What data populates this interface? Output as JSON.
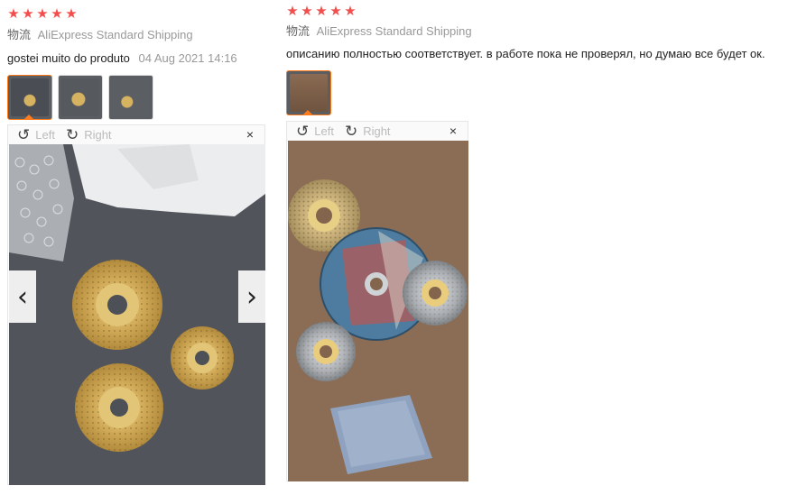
{
  "reviews": [
    {
      "stars": 5,
      "shipping_label": "物流",
      "shipping_method": "AliExpress Standard Shipping",
      "comment": "gostei muito do produto",
      "date": "04 Aug 2021 14:16",
      "thumbnails": 3,
      "viewer": {
        "rotate_left": "Left",
        "rotate_right": "Right",
        "close": "×",
        "prev": "‹",
        "next": "›"
      }
    },
    {
      "stars": 5,
      "shipping_label": "物流",
      "shipping_method": "AliExpress Standard Shipping",
      "comment": "описанию полностью соответствует. в работе пока не проверял, но думаю все будет ок.",
      "thumbnails": 1,
      "viewer": {
        "rotate_left": "Left",
        "rotate_right": "Right",
        "close": "×"
      }
    }
  ],
  "icons": {
    "star": "★",
    "rotate_left": "↺",
    "rotate_right": "↻"
  },
  "colors": {
    "star": "#f24e4e",
    "thumb_active_border": "#ff7a1a"
  }
}
